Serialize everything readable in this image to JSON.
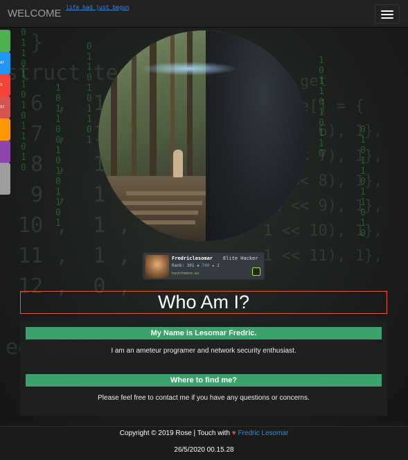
{
  "navbar": {
    "brand": "WELCOME",
    "tagline": "life had just begun",
    "menu_icon": "hamburger-icon"
  },
  "background": {
    "code_lines": [
      "  }",
      "struct test",
      "  6 ,  1 ,",
      "  7 ,  1 ,",
      "  8 ,  1 ,",
      "  9 ,  1 ,",
      " 10 ,  1 ,",
      " 11 ,  1 ,",
      " 12 ,  0 ,",
      "",
      "edThread:"
    ],
    "right_lines": [
      "(s0.get",
      "  age[] = {",
      " 1 << 6), 1},",
      " 1 << 7), 1},",
      " 1 << 8), 1},",
      " 1 << 9), 1},",
      "1 << 10), 1},",
      "1 << 11), 1},"
    ]
  },
  "side_bar": {
    "items": [
      {
        "label": "",
        "color": "#4caf50"
      },
      {
        "label": "AT",
        "color": "#2196f3"
      },
      {
        "label": "S",
        "color": "#f44336"
      },
      {
        "label": "ST",
        "color": "#d9534f"
      },
      {
        "label": "",
        "color": "#ff9800"
      },
      {
        "label": "",
        "color": "#8e44ad"
      },
      {
        "label": "",
        "color": "#9e9e9e"
      }
    ]
  },
  "badge": {
    "name": "Fredriclesomar",
    "rank_title": "Elite Hacker",
    "rank_label": "Rank: 301",
    "points": "740",
    "respect": "2",
    "site": "hackthebox.eu"
  },
  "heading": "Who Am I?",
  "sections": [
    {
      "title": "My Name is Lesomar Fredric.",
      "text": "I am an ameteur programer and network security enthusiast."
    },
    {
      "title": "Where to find me?",
      "text": "Please feel free to contact me if you have any questions or concerns."
    }
  ],
  "footer": {
    "copyright_prefix": "Copyright © 2019 Rose | Touch with",
    "heart": "♥",
    "author_link": "Fredric Lesomar",
    "datetime": "26/5/2020 00.15.28"
  }
}
